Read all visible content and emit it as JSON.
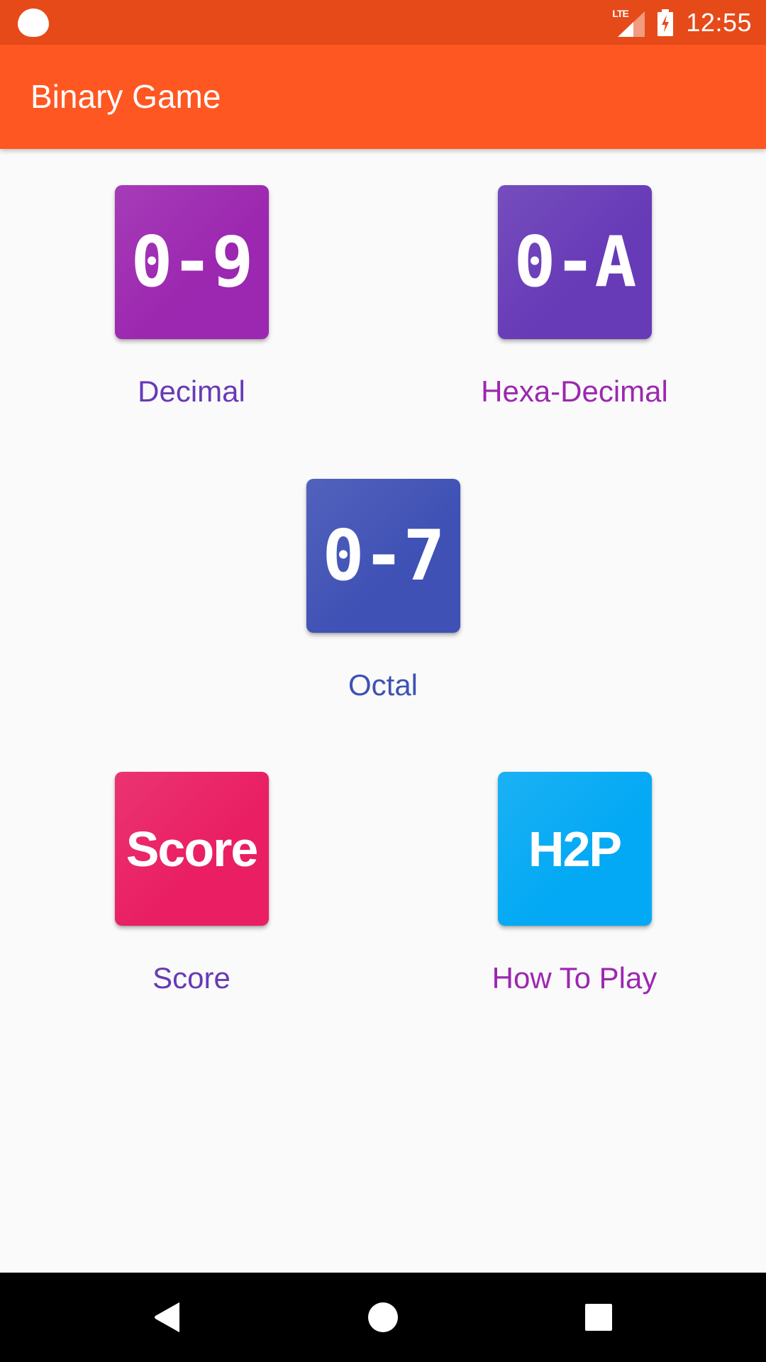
{
  "status_bar": {
    "notification_icon": "notification-blob-icon",
    "network_label": "LTE",
    "battery_icon": "battery-charging-icon",
    "time": "12:55"
  },
  "app_bar": {
    "title": "Binary Game",
    "background": "#FF5722",
    "status_background": "#E64A19"
  },
  "menu": {
    "items": [
      {
        "id": "decimal",
        "tile_text": "0-9",
        "label": "Decimal",
        "tile_color": "#9C27B0",
        "label_color": "#673AB7"
      },
      {
        "id": "hexadecimal",
        "tile_text": "0-A",
        "label": "Hexa-Decimal",
        "tile_color": "#673AB7",
        "label_color": "#9C27B0"
      },
      {
        "id": "octal",
        "tile_text": "0-7",
        "label": "Octal",
        "tile_color": "#3F51B5",
        "label_color": "#3F51B5"
      },
      {
        "id": "score",
        "tile_text": "Score",
        "label": "Score",
        "tile_color": "#E91E63",
        "label_color": "#673AB7"
      },
      {
        "id": "how-to-play",
        "tile_text": "H2P",
        "label": "How To Play",
        "tile_color": "#03A9F4",
        "label_color": "#9C27B0"
      }
    ]
  },
  "nav_bar": {
    "back": "back-icon",
    "home": "home-icon",
    "recents": "recents-icon"
  }
}
